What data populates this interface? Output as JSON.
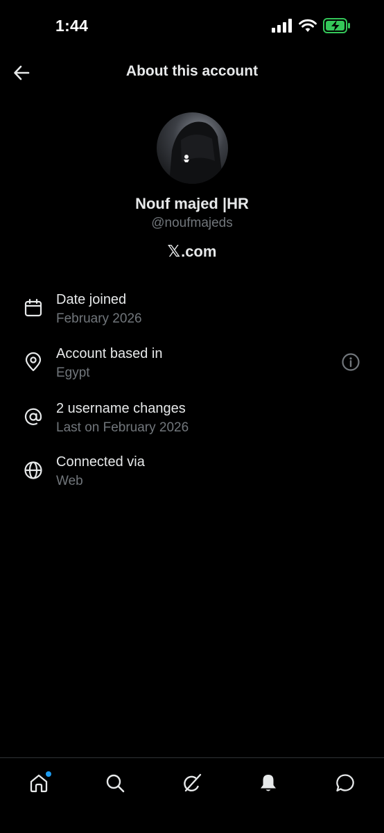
{
  "status_bar": {
    "time": "1:44"
  },
  "header": {
    "title": "About this account"
  },
  "profile": {
    "display_name": "Nouf majed |HR",
    "handle": "@noufmajeds",
    "site_glyph": "𝕏",
    "site_suffix": ".com"
  },
  "info": [
    {
      "title": "Date joined",
      "subtitle": "February 2026",
      "icon": "calendar-icon"
    },
    {
      "title": "Account based in",
      "subtitle": "Egypt",
      "icon": "location-pin-icon"
    },
    {
      "title": "2 username changes",
      "subtitle": "Last on February 2026",
      "icon": "at-sign-icon"
    },
    {
      "title": "Connected via",
      "subtitle": "Web",
      "icon": "globe-icon"
    }
  ],
  "bottom_nav": [
    {
      "name": "home",
      "icon": "home-icon",
      "has_notification_dot": true
    },
    {
      "name": "search",
      "icon": "search-icon"
    },
    {
      "name": "grok",
      "icon": "grok-icon"
    },
    {
      "name": "notifications",
      "icon": "bell-icon"
    },
    {
      "name": "messages",
      "icon": "message-icon"
    }
  ],
  "colors": {
    "background": "#000000",
    "primary_text": "#e7e9ea",
    "secondary_text": "#71767b",
    "accent": "#1d9bf0",
    "battery": "#34c759"
  }
}
